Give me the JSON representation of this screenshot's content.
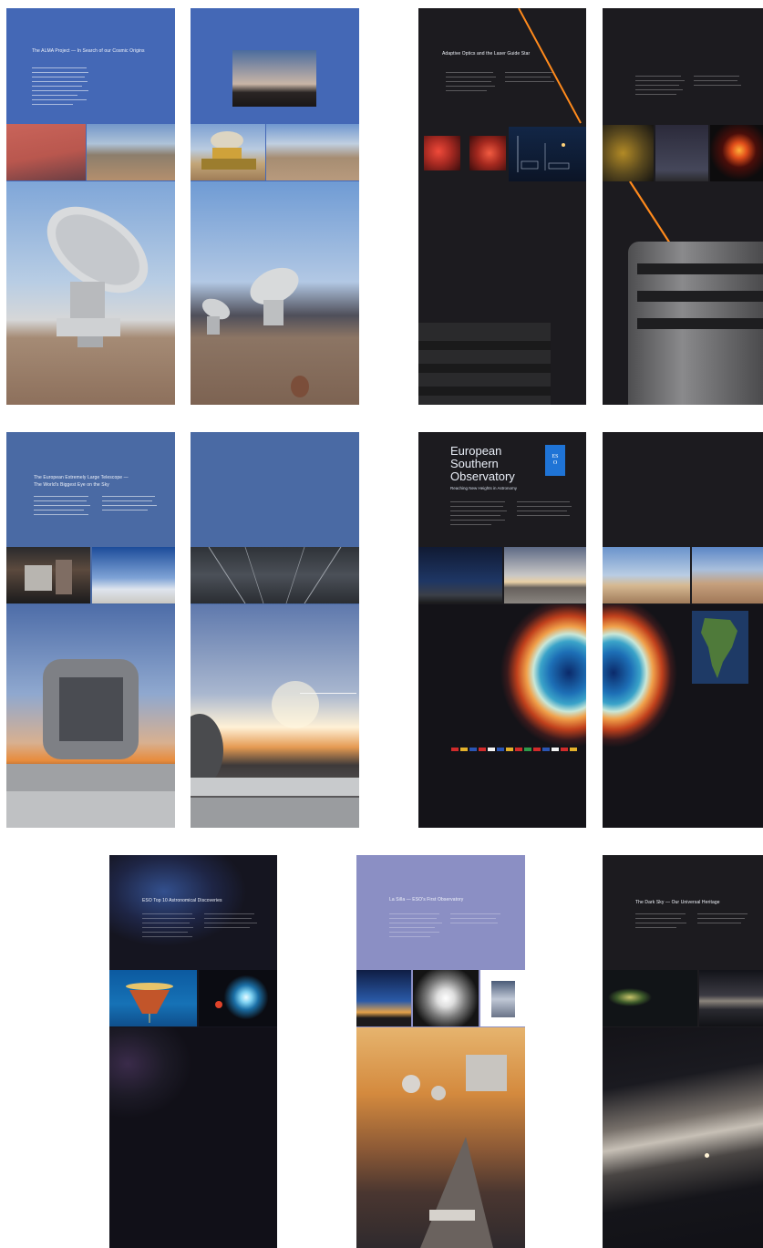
{
  "posters": [
    {
      "id": "alma",
      "title": "The ALMA Project — In Search of our Cosmic Origins"
    },
    {
      "id": "laser",
      "title": "Adaptive Optics and the Laser Guide Star"
    },
    {
      "id": "eelt",
      "title_line1": "The European Extremely Large Telescope —",
      "title_line2": "The World's Biggest Eye on the Sky"
    },
    {
      "id": "eso",
      "heading_line1": "European",
      "heading_line2": "Southern",
      "heading_line3": "Observatory",
      "subtitle": "Reaching New Heights in Astronomy",
      "logo_text": "ES O"
    },
    {
      "id": "top10",
      "title": "ESO Top 10 Astronomical Discoveries"
    },
    {
      "id": "lasilla",
      "title": "La Silla — ESO's First Observatory"
    },
    {
      "id": "darksky",
      "title": "The Dark Sky — Our Universal Heritage"
    }
  ],
  "colors": {
    "blue_header": "#4468b6",
    "steel_header": "#4a6aa4",
    "dark_bg": "#1b1a1f",
    "lavender_header": "#8b8fc4",
    "eso_logo": "#1f74d6",
    "laser": "#ff8a1c"
  }
}
